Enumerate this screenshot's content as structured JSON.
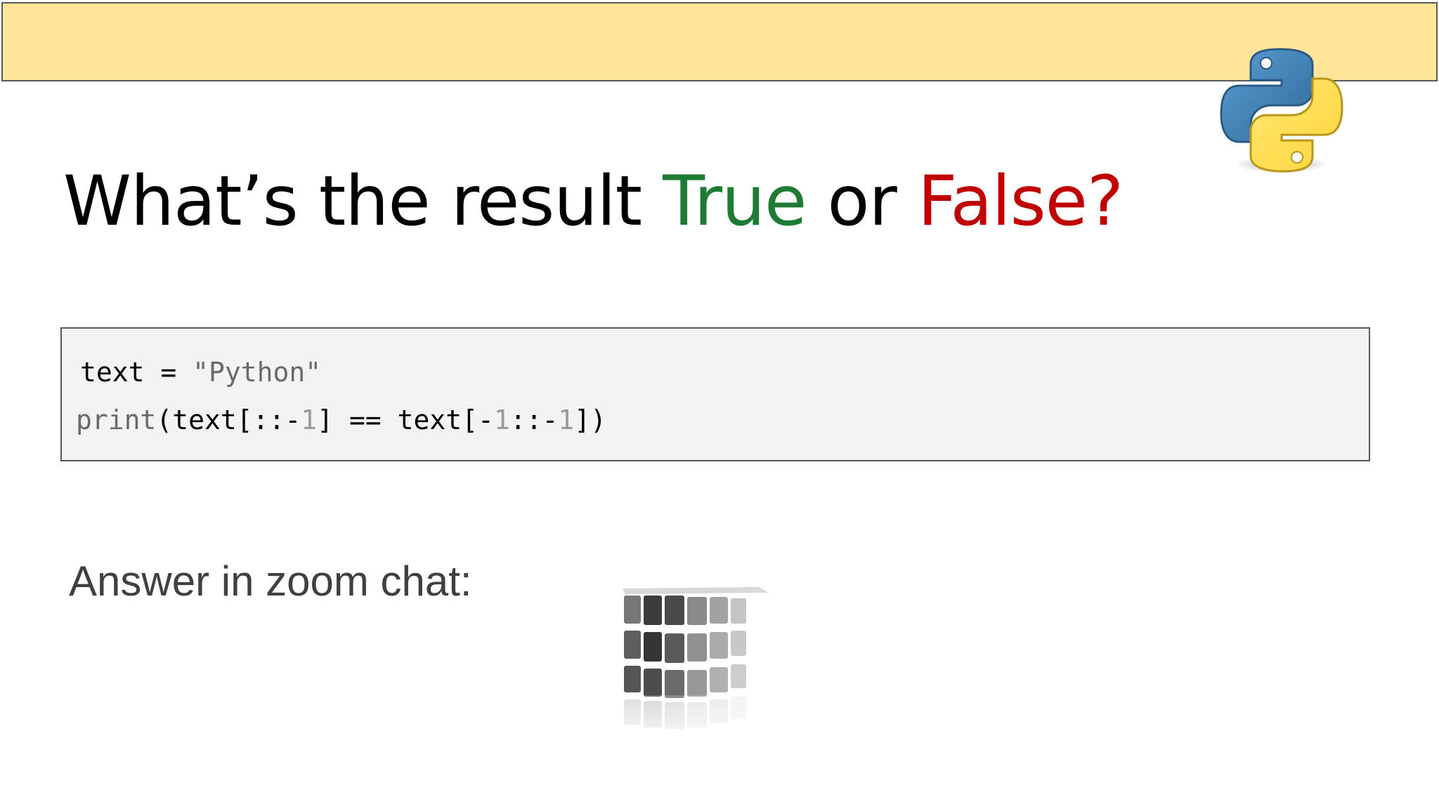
{
  "slide": {
    "title_prefix": "What’s the result ",
    "title_true": "True",
    "title_middle": " or ",
    "title_false": "False?",
    "answer_prompt": "Answer in zoom chat:"
  },
  "code": {
    "line1": {
      "var": "text",
      "assign": " = ",
      "string": "\"Python\""
    },
    "line2": {
      "builtin": "print",
      "part_a": "(text[::-",
      "num_a": "1",
      "part_b": "] == text[-",
      "num_b": "1",
      "part_c": "::-",
      "num_c": "1",
      "part_d": "])"
    }
  },
  "colors": {
    "header_bar": "#ffe599",
    "true_color": "#1e7b34",
    "false_color": "#c00000",
    "code_background": "#f3f3f3"
  },
  "icons": {
    "logo": "python-logo",
    "illustration": "cube-image"
  }
}
